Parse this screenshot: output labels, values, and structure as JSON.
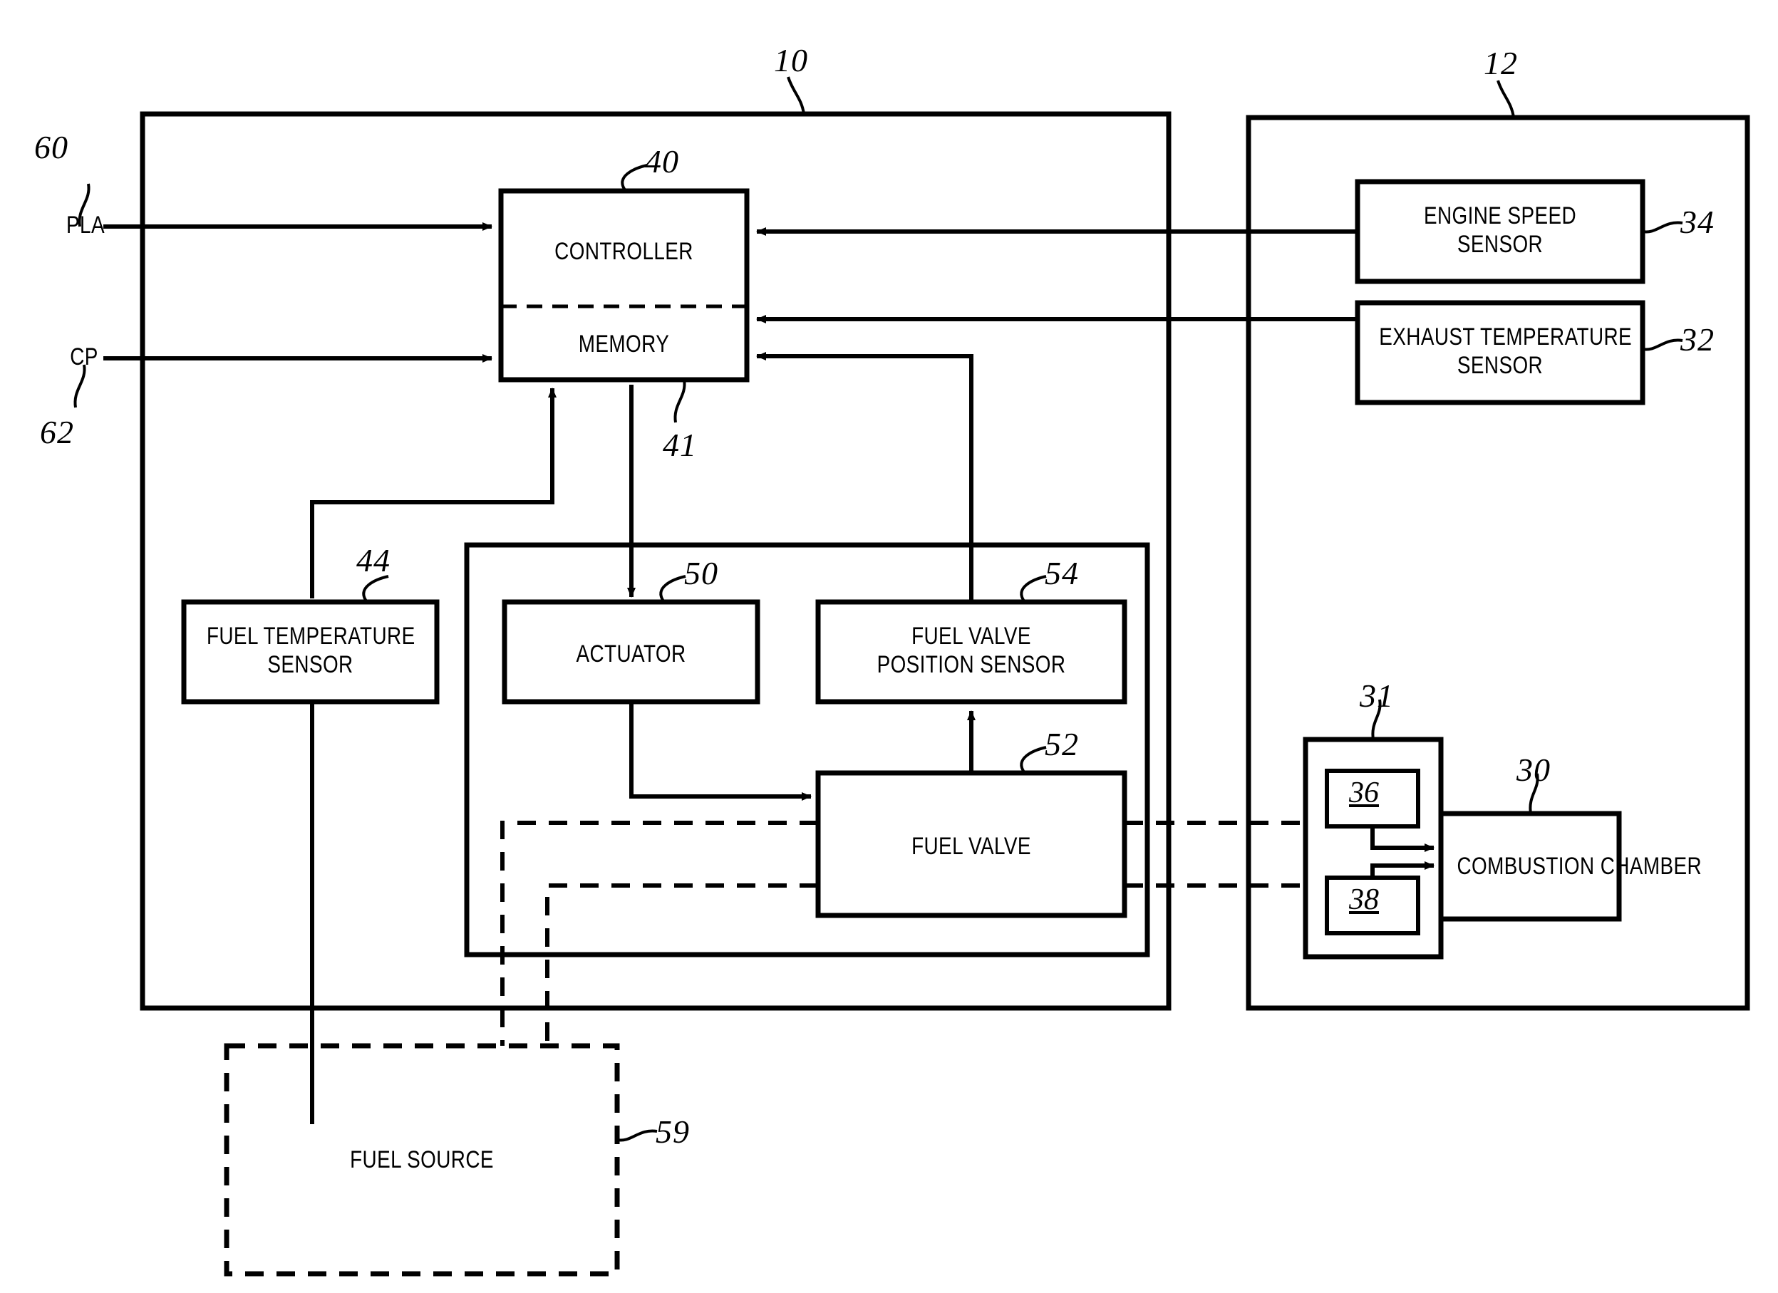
{
  "figure": {
    "type": "patent-block-diagram",
    "reference_numbers": {
      "system": "10",
      "engine": "12",
      "pla_signal": "60",
      "cp_signal": "62",
      "controller": "40",
      "memory": "41",
      "fuel_temperature_sensor": "44",
      "actuator": "50",
      "fuel_valve": "52",
      "fuel_valve_position_sensor": "54",
      "fuel_source": "59",
      "combustion_chamber": "30",
      "injector_assembly": "31",
      "exhaust_temperature_sensor": "32",
      "engine_speed_sensor": "34",
      "primary_injector": "36",
      "secondary_injector": "38"
    }
  },
  "signals": {
    "pla": "PLA",
    "cp": "CP"
  },
  "blocks": {
    "controller": "CONTROLLER",
    "memory": "MEMORY",
    "fuel_temperature_sensor": "FUEL TEMPERATURE\nSENSOR",
    "actuator": "ACTUATOR",
    "fuel_valve_position_sensor": "FUEL VALVE\nPOSITION SENSOR",
    "fuel_valve": "FUEL VALVE",
    "fuel_source": "FUEL SOURCE",
    "engine_speed_sensor": "ENGINE SPEED\nSENSOR",
    "exhaust_temperature_sensor": "EXHAUST TEMPERATURE\nSENSOR",
    "combustion_chamber": "COMBUSTION CHAMBER",
    "injector_primary": "36",
    "injector_secondary": "38"
  },
  "style": {
    "ink": "#000000",
    "paper": "#ffffff"
  }
}
